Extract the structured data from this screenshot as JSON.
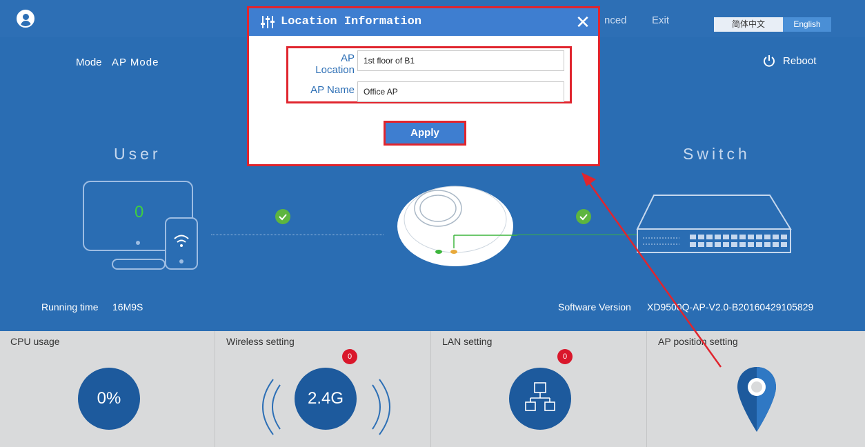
{
  "header": {
    "nav_advanced": "nced",
    "nav_exit": "Exit",
    "lang_zh": "简体中文",
    "lang_en": "English"
  },
  "status": {
    "mode_label": "Mode",
    "mode_value": "AP Mode",
    "reboot_label": "Reboot",
    "user_title": "User",
    "switch_title": "Switch",
    "user_count": "0",
    "running_label": "Running time",
    "running_value": "16M9S",
    "software_label": "Software Version",
    "software_value": "XD9500Q-AP-V2.0-B20160429105829"
  },
  "panels": {
    "cpu": {
      "title": "CPU usage",
      "value": "0%"
    },
    "wireless": {
      "title": "Wireless setting",
      "value": "2.4G",
      "badge": "0"
    },
    "lan": {
      "title": "LAN setting",
      "badge": "0"
    },
    "position": {
      "title": "AP position setting"
    }
  },
  "dialog": {
    "title": "Location Information",
    "close_symbol": "✕",
    "location_label": "AP Location",
    "location_value": "1st floor of B1",
    "name_label": "AP Name",
    "name_value": "Office AP",
    "apply_label": "Apply"
  },
  "colors": {
    "primary": "#2a6db3",
    "dialog_header": "#3e7ed0",
    "highlight": "#e0252e",
    "status_ok": "#5db53f",
    "badge": "#d9172b"
  }
}
